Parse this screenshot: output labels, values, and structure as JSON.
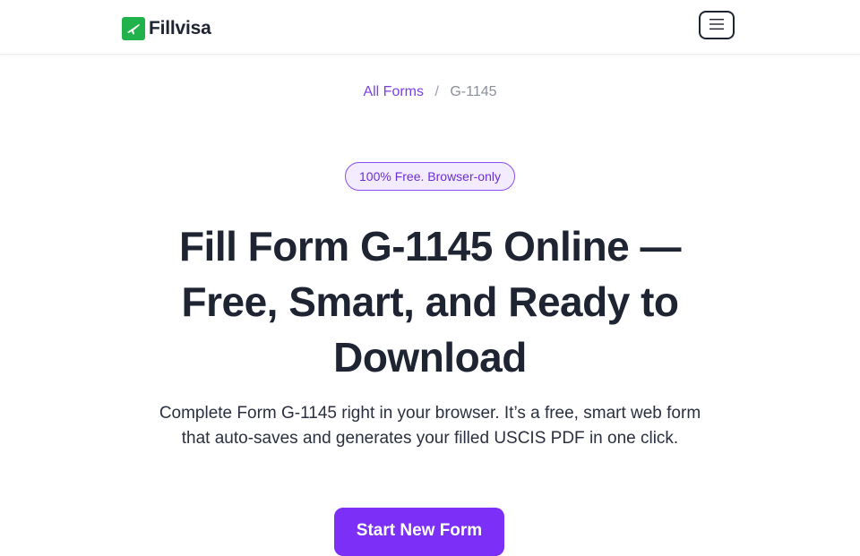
{
  "header": {
    "logo_text": "Fillvisa",
    "logo_icon": "plane-icon",
    "menu_icon": "hamburger-menu-icon",
    "brand_color": "#22b24c"
  },
  "breadcrumb": {
    "link": "All Forms",
    "separator": "/",
    "current": "G-1145"
  },
  "badge": {
    "label": "100% Free. Browser-only",
    "color": "#8b4cf0"
  },
  "hero": {
    "title": "Fill Form G-1145 Online — Free, Smart, and Ready to Download",
    "subtitle": "Complete Form G-1145 right in your browser. It’s a free, smart web form that auto-saves and generates your filled USCIS PDF in one click."
  },
  "cta": {
    "label": "Start New Form",
    "color": "#7b2ff7"
  }
}
